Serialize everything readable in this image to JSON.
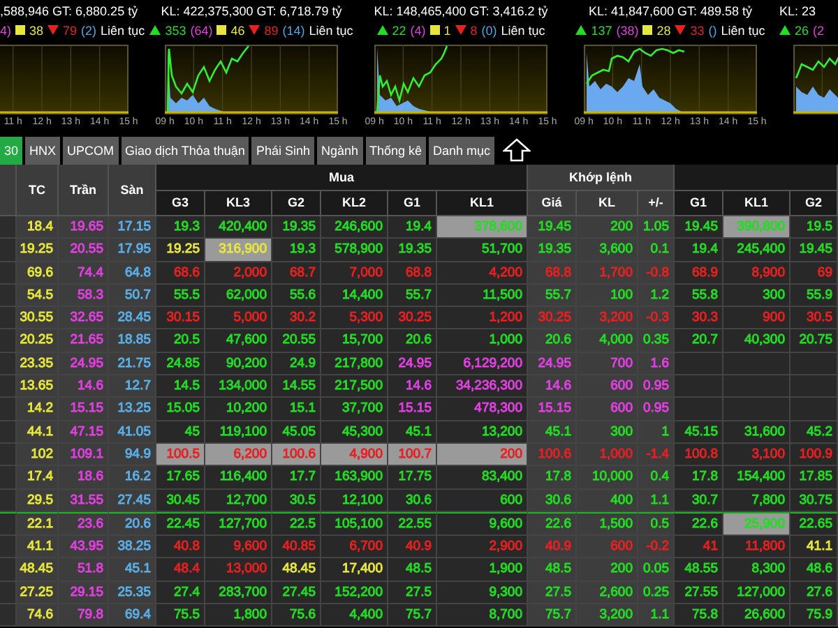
{
  "index_panels": [
    {
      "summary": ",588,946 GT: 6,880.25 tỷ",
      "ceiling": "4)",
      "unchanged": "38",
      "declines": "79",
      "floor": "(2)",
      "status": "Liên tục",
      "hours": [
        "11 h",
        "12 h",
        "13 h",
        "14 h",
        "15 h"
      ]
    },
    {
      "summary": "KL: 422,375,300 GT: 6,718.79 tỷ",
      "advances": "353",
      "ceiling": "(64)",
      "unchanged": "46",
      "declines": "89",
      "floor": "(14)",
      "status": "Liên tục",
      "hours": [
        "09 h",
        "10 h",
        "11 h",
        "12 h",
        "13 h",
        "14 h",
        "15 h"
      ]
    },
    {
      "summary": "KL: 148,465,400 GT: 3,416.2 tỷ",
      "advances": "22",
      "ceiling": "(4)",
      "unchanged": "1",
      "declines": "8",
      "floor": "(0)",
      "status": "Liên tục",
      "hours": [
        "09 h",
        "10 h",
        "11 h",
        "12 h",
        "13 h",
        "14 h",
        "15 h"
      ]
    },
    {
      "summary": "KL: 41,847,600 GT: 489.58 tỷ",
      "advances": "137",
      "ceiling": "(38)",
      "unchanged": "28",
      "declines": "33",
      "floor": "()",
      "status": "Liên tục",
      "hours": [
        "09 h",
        "10 h",
        "11 h",
        "12 h",
        "13 h",
        "14 h",
        "15 h"
      ]
    },
    {
      "summary": "KL: 23",
      "advances": "26",
      "ceiling": "(2"
    }
  ],
  "tabs": [
    {
      "label": "30",
      "selected": true
    },
    {
      "label": "HNX",
      "selected": false
    },
    {
      "label": "UPCOM",
      "selected": false
    },
    {
      "label": "Giao dịch Thỏa thuận",
      "selected": false
    },
    {
      "label": "Phái Sinh",
      "selected": false
    },
    {
      "label": "Ngành",
      "selected": false
    },
    {
      "label": "Thống kê",
      "selected": false
    },
    {
      "label": "Danh mục",
      "selected": false
    }
  ],
  "table": {
    "fixed_columns": [
      "TC",
      "Trần",
      "Sàn"
    ],
    "group_buy": "Mua",
    "group_match": "Khớp lệnh",
    "buy_columns": [
      "G3",
      "KL3",
      "G2",
      "KL2",
      "G1",
      "KL1"
    ],
    "match_columns": [
      "Giá",
      "KL",
      "+/-"
    ],
    "sell_columns": [
      "G1",
      "KL1",
      "G2"
    ],
    "rows": [
      {
        "separator_above": false,
        "cells": [
          {
            "text": "18.4",
            "color": "#e6e63c",
            "highlighted": false
          },
          {
            "text": "19.65",
            "color": "#e040e0",
            "highlighted": false
          },
          {
            "text": "17.15",
            "color": "#5aaee6",
            "highlighted": false
          },
          {
            "text": "19.3",
            "color": "#22dd22",
            "highlighted": false
          },
          {
            "text": "420,400",
            "color": "#22dd22",
            "highlighted": false
          },
          {
            "text": "19.35",
            "color": "#22dd22",
            "highlighted": false
          },
          {
            "text": "246,600",
            "color": "#22dd22",
            "highlighted": false
          },
          {
            "text": "19.4",
            "color": "#22dd22",
            "highlighted": false
          },
          {
            "text": "378,600",
            "color": "#22dd22",
            "highlighted": true
          },
          {
            "text": "19.45",
            "color": "#22dd22",
            "highlighted": false
          },
          {
            "text": "200",
            "color": "#22dd22",
            "highlighted": false
          },
          {
            "text": "1.05",
            "color": "#22dd22",
            "highlighted": false
          },
          {
            "text": "19.45",
            "color": "#22dd22",
            "highlighted": false
          },
          {
            "text": "390,800",
            "color": "#22dd22",
            "highlighted": true
          },
          {
            "text": "19.5",
            "color": "#22dd22",
            "highlighted": false
          }
        ]
      },
      {
        "separator_above": false,
        "cells": [
          {
            "text": "19.25",
            "color": "#e6e63c",
            "highlighted": false
          },
          {
            "text": "20.55",
            "color": "#e040e0",
            "highlighted": false
          },
          {
            "text": "17.95",
            "color": "#5aaee6",
            "highlighted": false
          },
          {
            "text": "19.25",
            "color": "#e6e63c",
            "highlighted": false
          },
          {
            "text": "316,900",
            "color": "#e6e63c",
            "highlighted": true
          },
          {
            "text": "19.3",
            "color": "#22dd22",
            "highlighted": false
          },
          {
            "text": "578,900",
            "color": "#22dd22",
            "highlighted": false
          },
          {
            "text": "19.35",
            "color": "#22dd22",
            "highlighted": false
          },
          {
            "text": "51,700",
            "color": "#22dd22",
            "highlighted": false
          },
          {
            "text": "19.35",
            "color": "#22dd22",
            "highlighted": false
          },
          {
            "text": "3,600",
            "color": "#22dd22",
            "highlighted": false
          },
          {
            "text": "0.1",
            "color": "#22dd22",
            "highlighted": false
          },
          {
            "text": "19.4",
            "color": "#22dd22",
            "highlighted": false
          },
          {
            "text": "245,400",
            "color": "#22dd22",
            "highlighted": false
          },
          {
            "text": "19.45",
            "color": "#22dd22",
            "highlighted": false
          }
        ]
      },
      {
        "separator_above": false,
        "cells": [
          {
            "text": "69.6",
            "color": "#e6e63c",
            "highlighted": false
          },
          {
            "text": "74.4",
            "color": "#e040e0",
            "highlighted": false
          },
          {
            "text": "64.8",
            "color": "#5aaee6",
            "highlighted": false
          },
          {
            "text": "68.6",
            "color": "#e82020",
            "highlighted": false
          },
          {
            "text": "2,000",
            "color": "#e82020",
            "highlighted": false
          },
          {
            "text": "68.7",
            "color": "#e82020",
            "highlighted": false
          },
          {
            "text": "7,000",
            "color": "#e82020",
            "highlighted": false
          },
          {
            "text": "68.8",
            "color": "#e82020",
            "highlighted": false
          },
          {
            "text": "4,200",
            "color": "#e82020",
            "highlighted": false
          },
          {
            "text": "68.8",
            "color": "#e82020",
            "highlighted": false
          },
          {
            "text": "1,700",
            "color": "#e82020",
            "highlighted": false
          },
          {
            "text": "-0.8",
            "color": "#e82020",
            "highlighted": false
          },
          {
            "text": "68.9",
            "color": "#e82020",
            "highlighted": false
          },
          {
            "text": "8,900",
            "color": "#e82020",
            "highlighted": false
          },
          {
            "text": "69",
            "color": "#e82020",
            "highlighted": false
          }
        ]
      },
      {
        "separator_above": false,
        "cells": [
          {
            "text": "54.5",
            "color": "#e6e63c",
            "highlighted": false
          },
          {
            "text": "58.3",
            "color": "#e040e0",
            "highlighted": false
          },
          {
            "text": "50.7",
            "color": "#5aaee6",
            "highlighted": false
          },
          {
            "text": "55.5",
            "color": "#22dd22",
            "highlighted": false
          },
          {
            "text": "62,000",
            "color": "#22dd22",
            "highlighted": false
          },
          {
            "text": "55.6",
            "color": "#22dd22",
            "highlighted": false
          },
          {
            "text": "14,400",
            "color": "#22dd22",
            "highlighted": false
          },
          {
            "text": "55.7",
            "color": "#22dd22",
            "highlighted": false
          },
          {
            "text": "11,500",
            "color": "#22dd22",
            "highlighted": false
          },
          {
            "text": "55.7",
            "color": "#22dd22",
            "highlighted": false
          },
          {
            "text": "100",
            "color": "#22dd22",
            "highlighted": false
          },
          {
            "text": "1.2",
            "color": "#22dd22",
            "highlighted": false
          },
          {
            "text": "55.8",
            "color": "#22dd22",
            "highlighted": false
          },
          {
            "text": "300",
            "color": "#22dd22",
            "highlighted": false
          },
          {
            "text": "55.9",
            "color": "#22dd22",
            "highlighted": false
          }
        ]
      },
      {
        "separator_above": false,
        "cells": [
          {
            "text": "30.55",
            "color": "#e6e63c",
            "highlighted": false
          },
          {
            "text": "32.65",
            "color": "#e040e0",
            "highlighted": false
          },
          {
            "text": "28.45",
            "color": "#5aaee6",
            "highlighted": false
          },
          {
            "text": "30.15",
            "color": "#e82020",
            "highlighted": false
          },
          {
            "text": "5,000",
            "color": "#e82020",
            "highlighted": false
          },
          {
            "text": "30.2",
            "color": "#e82020",
            "highlighted": false
          },
          {
            "text": "5,300",
            "color": "#e82020",
            "highlighted": false
          },
          {
            "text": "30.25",
            "color": "#e82020",
            "highlighted": false
          },
          {
            "text": "1,200",
            "color": "#e82020",
            "highlighted": false
          },
          {
            "text": "30.25",
            "color": "#e82020",
            "highlighted": false
          },
          {
            "text": "3,200",
            "color": "#e82020",
            "highlighted": false
          },
          {
            "text": "-0.3",
            "color": "#e82020",
            "highlighted": false
          },
          {
            "text": "30.3",
            "color": "#e82020",
            "highlighted": false
          },
          {
            "text": "900",
            "color": "#e82020",
            "highlighted": false
          },
          {
            "text": "30.5",
            "color": "#e82020",
            "highlighted": false
          }
        ]
      },
      {
        "separator_above": false,
        "cells": [
          {
            "text": "20.25",
            "color": "#e6e63c",
            "highlighted": false
          },
          {
            "text": "21.65",
            "color": "#e040e0",
            "highlighted": false
          },
          {
            "text": "18.85",
            "color": "#5aaee6",
            "highlighted": false
          },
          {
            "text": "20.5",
            "color": "#22dd22",
            "highlighted": false
          },
          {
            "text": "47,600",
            "color": "#22dd22",
            "highlighted": false
          },
          {
            "text": "20.55",
            "color": "#22dd22",
            "highlighted": false
          },
          {
            "text": "15,700",
            "color": "#22dd22",
            "highlighted": false
          },
          {
            "text": "20.6",
            "color": "#22dd22",
            "highlighted": false
          },
          {
            "text": "1,000",
            "color": "#22dd22",
            "highlighted": false
          },
          {
            "text": "20.6",
            "color": "#22dd22",
            "highlighted": false
          },
          {
            "text": "4,000",
            "color": "#22dd22",
            "highlighted": false
          },
          {
            "text": "0.35",
            "color": "#22dd22",
            "highlighted": false
          },
          {
            "text": "20.7",
            "color": "#22dd22",
            "highlighted": false
          },
          {
            "text": "40,300",
            "color": "#22dd22",
            "highlighted": false
          },
          {
            "text": "20.75",
            "color": "#22dd22",
            "highlighted": false
          }
        ]
      },
      {
        "separator_above": false,
        "cells": [
          {
            "text": "23.35",
            "color": "#e6e63c",
            "highlighted": false
          },
          {
            "text": "24.95",
            "color": "#e040e0",
            "highlighted": false
          },
          {
            "text": "21.75",
            "color": "#5aaee6",
            "highlighted": false
          },
          {
            "text": "24.85",
            "color": "#22dd22",
            "highlighted": false
          },
          {
            "text": "90,200",
            "color": "#22dd22",
            "highlighted": false
          },
          {
            "text": "24.9",
            "color": "#22dd22",
            "highlighted": false
          },
          {
            "text": "217,800",
            "color": "#22dd22",
            "highlighted": false
          },
          {
            "text": "24.95",
            "color": "#e040e0",
            "highlighted": false
          },
          {
            "text": "6,129,200",
            "color": "#e040e0",
            "highlighted": false
          },
          {
            "text": "24.95",
            "color": "#e040e0",
            "highlighted": false
          },
          {
            "text": "700",
            "color": "#e040e0",
            "highlighted": false
          },
          {
            "text": "1.6",
            "color": "#e040e0",
            "highlighted": false
          }
        ]
      },
      {
        "separator_above": false,
        "cells": [
          {
            "text": "13.65",
            "color": "#e6e63c",
            "highlighted": false
          },
          {
            "text": "14.6",
            "color": "#e040e0",
            "highlighted": false
          },
          {
            "text": "12.7",
            "color": "#5aaee6",
            "highlighted": false
          },
          {
            "text": "14.5",
            "color": "#22dd22",
            "highlighted": false
          },
          {
            "text": "134,000",
            "color": "#22dd22",
            "highlighted": false
          },
          {
            "text": "14.55",
            "color": "#22dd22",
            "highlighted": false
          },
          {
            "text": "217,500",
            "color": "#22dd22",
            "highlighted": false
          },
          {
            "text": "14.6",
            "color": "#e040e0",
            "highlighted": false
          },
          {
            "text": "34,236,300",
            "color": "#e040e0",
            "highlighted": false
          },
          {
            "text": "14.6",
            "color": "#e040e0",
            "highlighted": false
          },
          {
            "text": "600",
            "color": "#e040e0",
            "highlighted": false
          },
          {
            "text": "0.95",
            "color": "#e040e0",
            "highlighted": false
          }
        ]
      },
      {
        "separator_above": false,
        "cells": [
          {
            "text": "14.2",
            "color": "#e6e63c",
            "highlighted": false
          },
          {
            "text": "15.15",
            "color": "#e040e0",
            "highlighted": false
          },
          {
            "text": "13.25",
            "color": "#5aaee6",
            "highlighted": false
          },
          {
            "text": "15.05",
            "color": "#22dd22",
            "highlighted": false
          },
          {
            "text": "10,200",
            "color": "#22dd22",
            "highlighted": false
          },
          {
            "text": "15.1",
            "color": "#22dd22",
            "highlighted": false
          },
          {
            "text": "37,700",
            "color": "#22dd22",
            "highlighted": false
          },
          {
            "text": "15.15",
            "color": "#e040e0",
            "highlighted": false
          },
          {
            "text": "478,300",
            "color": "#e040e0",
            "highlighted": false
          },
          {
            "text": "15.15",
            "color": "#e040e0",
            "highlighted": false
          },
          {
            "text": "600",
            "color": "#e040e0",
            "highlighted": false
          },
          {
            "text": "0.95",
            "color": "#e040e0",
            "highlighted": false
          }
        ]
      },
      {
        "separator_above": false,
        "cells": [
          {
            "text": "44.1",
            "color": "#e6e63c",
            "highlighted": false
          },
          {
            "text": "47.15",
            "color": "#e040e0",
            "highlighted": false
          },
          {
            "text": "41.05",
            "color": "#5aaee6",
            "highlighted": false
          },
          {
            "text": "45",
            "color": "#22dd22",
            "highlighted": false
          },
          {
            "text": "119,100",
            "color": "#22dd22",
            "highlighted": false
          },
          {
            "text": "45.05",
            "color": "#22dd22",
            "highlighted": false
          },
          {
            "text": "45,300",
            "color": "#22dd22",
            "highlighted": false
          },
          {
            "text": "45.1",
            "color": "#22dd22",
            "highlighted": false
          },
          {
            "text": "13,200",
            "color": "#22dd22",
            "highlighted": false
          },
          {
            "text": "45.1",
            "color": "#22dd22",
            "highlighted": false
          },
          {
            "text": "300",
            "color": "#22dd22",
            "highlighted": false
          },
          {
            "text": "1",
            "color": "#22dd22",
            "highlighted": false
          },
          {
            "text": "45.15",
            "color": "#22dd22",
            "highlighted": false
          },
          {
            "text": "31,600",
            "color": "#22dd22",
            "highlighted": false
          },
          {
            "text": "45.2",
            "color": "#22dd22",
            "highlighted": false
          }
        ]
      },
      {
        "separator_above": false,
        "cells": [
          {
            "text": "102",
            "color": "#e6e63c",
            "highlighted": false
          },
          {
            "text": "109.1",
            "color": "#e040e0",
            "highlighted": false
          },
          {
            "text": "94.9",
            "color": "#5aaee6",
            "highlighted": false
          },
          {
            "text": "100.5",
            "color": "#e82020",
            "highlighted": true
          },
          {
            "text": "6,200",
            "color": "#e82020",
            "highlighted": true
          },
          {
            "text": "100.6",
            "color": "#e82020",
            "highlighted": true
          },
          {
            "text": "4,900",
            "color": "#e82020",
            "highlighted": true
          },
          {
            "text": "100.7",
            "color": "#e82020",
            "highlighted": true
          },
          {
            "text": "200",
            "color": "#e82020",
            "highlighted": true
          },
          {
            "text": "100.6",
            "color": "#e82020",
            "highlighted": false
          },
          {
            "text": "1,000",
            "color": "#e82020",
            "highlighted": false
          },
          {
            "text": "-1.4",
            "color": "#e82020",
            "highlighted": false
          },
          {
            "text": "100.8",
            "color": "#e82020",
            "highlighted": false
          },
          {
            "text": "3,100",
            "color": "#e82020",
            "highlighted": false
          },
          {
            "text": "100.9",
            "color": "#e82020",
            "highlighted": false
          }
        ]
      },
      {
        "separator_above": false,
        "cells": [
          {
            "text": "17.4",
            "color": "#e6e63c",
            "highlighted": false
          },
          {
            "text": "18.6",
            "color": "#e040e0",
            "highlighted": false
          },
          {
            "text": "16.2",
            "color": "#5aaee6",
            "highlighted": false
          },
          {
            "text": "17.65",
            "color": "#22dd22",
            "highlighted": false
          },
          {
            "text": "116,400",
            "color": "#22dd22",
            "highlighted": false
          },
          {
            "text": "17.7",
            "color": "#22dd22",
            "highlighted": false
          },
          {
            "text": "163,900",
            "color": "#22dd22",
            "highlighted": false
          },
          {
            "text": "17.75",
            "color": "#22dd22",
            "highlighted": false
          },
          {
            "text": "83,400",
            "color": "#22dd22",
            "highlighted": false
          },
          {
            "text": "17.8",
            "color": "#22dd22",
            "highlighted": false
          },
          {
            "text": "10,000",
            "color": "#22dd22",
            "highlighted": false
          },
          {
            "text": "0.4",
            "color": "#22dd22",
            "highlighted": false
          },
          {
            "text": "17.8",
            "color": "#22dd22",
            "highlighted": false
          },
          {
            "text": "154,400",
            "color": "#22dd22",
            "highlighted": false
          },
          {
            "text": "17.85",
            "color": "#22dd22",
            "highlighted": false
          }
        ]
      },
      {
        "separator_above": false,
        "cells": [
          {
            "text": "29.5",
            "color": "#e6e63c",
            "highlighted": false
          },
          {
            "text": "31.55",
            "color": "#e040e0",
            "highlighted": false
          },
          {
            "text": "27.45",
            "color": "#5aaee6",
            "highlighted": false
          },
          {
            "text": "30.45",
            "color": "#22dd22",
            "highlighted": false
          },
          {
            "text": "12,700",
            "color": "#22dd22",
            "highlighted": false
          },
          {
            "text": "30.5",
            "color": "#22dd22",
            "highlighted": false
          },
          {
            "text": "12,100",
            "color": "#22dd22",
            "highlighted": false
          },
          {
            "text": "30.6",
            "color": "#22dd22",
            "highlighted": false
          },
          {
            "text": "600",
            "color": "#22dd22",
            "highlighted": false
          },
          {
            "text": "30.6",
            "color": "#22dd22",
            "highlighted": false
          },
          {
            "text": "400",
            "color": "#22dd22",
            "highlighted": false
          },
          {
            "text": "1.1",
            "color": "#22dd22",
            "highlighted": false
          },
          {
            "text": "30.7",
            "color": "#22dd22",
            "highlighted": false
          },
          {
            "text": "7,800",
            "color": "#22dd22",
            "highlighted": false
          },
          {
            "text": "30.75",
            "color": "#22dd22",
            "highlighted": false
          }
        ]
      },
      {
        "separator_above": true,
        "cells": [
          {
            "text": "22.1",
            "color": "#e6e63c",
            "highlighted": false
          },
          {
            "text": "23.6",
            "color": "#e040e0",
            "highlighted": false
          },
          {
            "text": "20.6",
            "color": "#5aaee6",
            "highlighted": false
          },
          {
            "text": "22.45",
            "color": "#22dd22",
            "highlighted": false
          },
          {
            "text": "127,700",
            "color": "#22dd22",
            "highlighted": false
          },
          {
            "text": "22.5",
            "color": "#22dd22",
            "highlighted": false
          },
          {
            "text": "105,100",
            "color": "#22dd22",
            "highlighted": false
          },
          {
            "text": "22.55",
            "color": "#22dd22",
            "highlighted": false
          },
          {
            "text": "9,600",
            "color": "#22dd22",
            "highlighted": false
          },
          {
            "text": "22.6",
            "color": "#22dd22",
            "highlighted": false
          },
          {
            "text": "1,500",
            "color": "#22dd22",
            "highlighted": false
          },
          {
            "text": "0.5",
            "color": "#22dd22",
            "highlighted": false
          },
          {
            "text": "22.6",
            "color": "#22dd22",
            "highlighted": false
          },
          {
            "text": "25,900",
            "color": "#22dd22",
            "highlighted": true
          },
          {
            "text": "22.65",
            "color": "#22dd22",
            "highlighted": false
          }
        ]
      },
      {
        "separator_above": false,
        "cells": [
          {
            "text": "41.1",
            "color": "#e6e63c",
            "highlighted": false
          },
          {
            "text": "43.95",
            "color": "#e040e0",
            "highlighted": false
          },
          {
            "text": "38.25",
            "color": "#5aaee6",
            "highlighted": false
          },
          {
            "text": "40.8",
            "color": "#e82020",
            "highlighted": false
          },
          {
            "text": "9,600",
            "color": "#e82020",
            "highlighted": false
          },
          {
            "text": "40.85",
            "color": "#e82020",
            "highlighted": false
          },
          {
            "text": "6,700",
            "color": "#e82020",
            "highlighted": false
          },
          {
            "text": "40.9",
            "color": "#e82020",
            "highlighted": false
          },
          {
            "text": "2,900",
            "color": "#e82020",
            "highlighted": false
          },
          {
            "text": "40.9",
            "color": "#e82020",
            "highlighted": false
          },
          {
            "text": "600",
            "color": "#e82020",
            "highlighted": false
          },
          {
            "text": "-0.2",
            "color": "#e82020",
            "highlighted": false
          },
          {
            "text": "41",
            "color": "#e82020",
            "highlighted": false
          },
          {
            "text": "11,800",
            "color": "#e82020",
            "highlighted": false
          },
          {
            "text": "41.1",
            "color": "#e6e63c",
            "highlighted": false
          }
        ]
      },
      {
        "separator_above": false,
        "cells": [
          {
            "text": "48.45",
            "color": "#e6e63c",
            "highlighted": false
          },
          {
            "text": "51.8",
            "color": "#e040e0",
            "highlighted": false
          },
          {
            "text": "45.1",
            "color": "#5aaee6",
            "highlighted": false
          },
          {
            "text": "48.4",
            "color": "#e82020",
            "highlighted": false
          },
          {
            "text": "13,000",
            "color": "#e82020",
            "highlighted": false
          },
          {
            "text": "48.45",
            "color": "#e6e63c",
            "highlighted": false
          },
          {
            "text": "17,400",
            "color": "#e6e63c",
            "highlighted": false
          },
          {
            "text": "48.5",
            "color": "#22dd22",
            "highlighted": false
          },
          {
            "text": "1,900",
            "color": "#22dd22",
            "highlighted": false
          },
          {
            "text": "48.5",
            "color": "#22dd22",
            "highlighted": false
          },
          {
            "text": "200",
            "color": "#22dd22",
            "highlighted": false
          },
          {
            "text": "0.05",
            "color": "#22dd22",
            "highlighted": false
          },
          {
            "text": "48.55",
            "color": "#22dd22",
            "highlighted": false
          },
          {
            "text": "8,300",
            "color": "#22dd22",
            "highlighted": false
          },
          {
            "text": "48.6",
            "color": "#22dd22",
            "highlighted": false
          }
        ]
      },
      {
        "separator_above": false,
        "cells": [
          {
            "text": "27.25",
            "color": "#e6e63c",
            "highlighted": false
          },
          {
            "text": "29.15",
            "color": "#e040e0",
            "highlighted": false
          },
          {
            "text": "25.35",
            "color": "#5aaee6",
            "highlighted": false
          },
          {
            "text": "27.4",
            "color": "#22dd22",
            "highlighted": false
          },
          {
            "text": "283,700",
            "color": "#22dd22",
            "highlighted": false
          },
          {
            "text": "27.45",
            "color": "#22dd22",
            "highlighted": false
          },
          {
            "text": "152,200",
            "color": "#22dd22",
            "highlighted": false
          },
          {
            "text": "27.5",
            "color": "#22dd22",
            "highlighted": false
          },
          {
            "text": "9,300",
            "color": "#22dd22",
            "highlighted": false
          },
          {
            "text": "27.5",
            "color": "#22dd22",
            "highlighted": false
          },
          {
            "text": "2,600",
            "color": "#22dd22",
            "highlighted": false
          },
          {
            "text": "0.25",
            "color": "#22dd22",
            "highlighted": false
          },
          {
            "text": "27.55",
            "color": "#22dd22",
            "highlighted": false
          },
          {
            "text": "127,000",
            "color": "#22dd22",
            "highlighted": false
          },
          {
            "text": "27.6",
            "color": "#22dd22",
            "highlighted": false
          }
        ]
      },
      {
        "separator_above": false,
        "cells": [
          {
            "text": "74.6",
            "color": "#e6e63c",
            "highlighted": false
          },
          {
            "text": "79.8",
            "color": "#e040e0",
            "highlighted": false
          },
          {
            "text": "69.4",
            "color": "#5aaee6",
            "highlighted": false
          },
          {
            "text": "75.5",
            "color": "#22dd22",
            "highlighted": false
          },
          {
            "text": "1,800",
            "color": "#22dd22",
            "highlighted": false
          },
          {
            "text": "75.6",
            "color": "#22dd22",
            "highlighted": false
          },
          {
            "text": "4,400",
            "color": "#22dd22",
            "highlighted": false
          },
          {
            "text": "75.7",
            "color": "#22dd22",
            "highlighted": false
          },
          {
            "text": "8,700",
            "color": "#22dd22",
            "highlighted": false
          },
          {
            "text": "75.7",
            "color": "#22dd22",
            "highlighted": false
          },
          {
            "text": "3,200",
            "color": "#22dd22",
            "highlighted": false
          },
          {
            "text": "1.1",
            "color": "#22dd22",
            "highlighted": false
          },
          {
            "text": "75.8",
            "color": "#22dd22",
            "highlighted": false
          },
          {
            "text": "26,600",
            "color": "#22dd22",
            "highlighted": false
          },
          {
            "text": "75.9",
            "color": "#22dd22",
            "highlighted": false
          }
        ]
      }
    ]
  }
}
